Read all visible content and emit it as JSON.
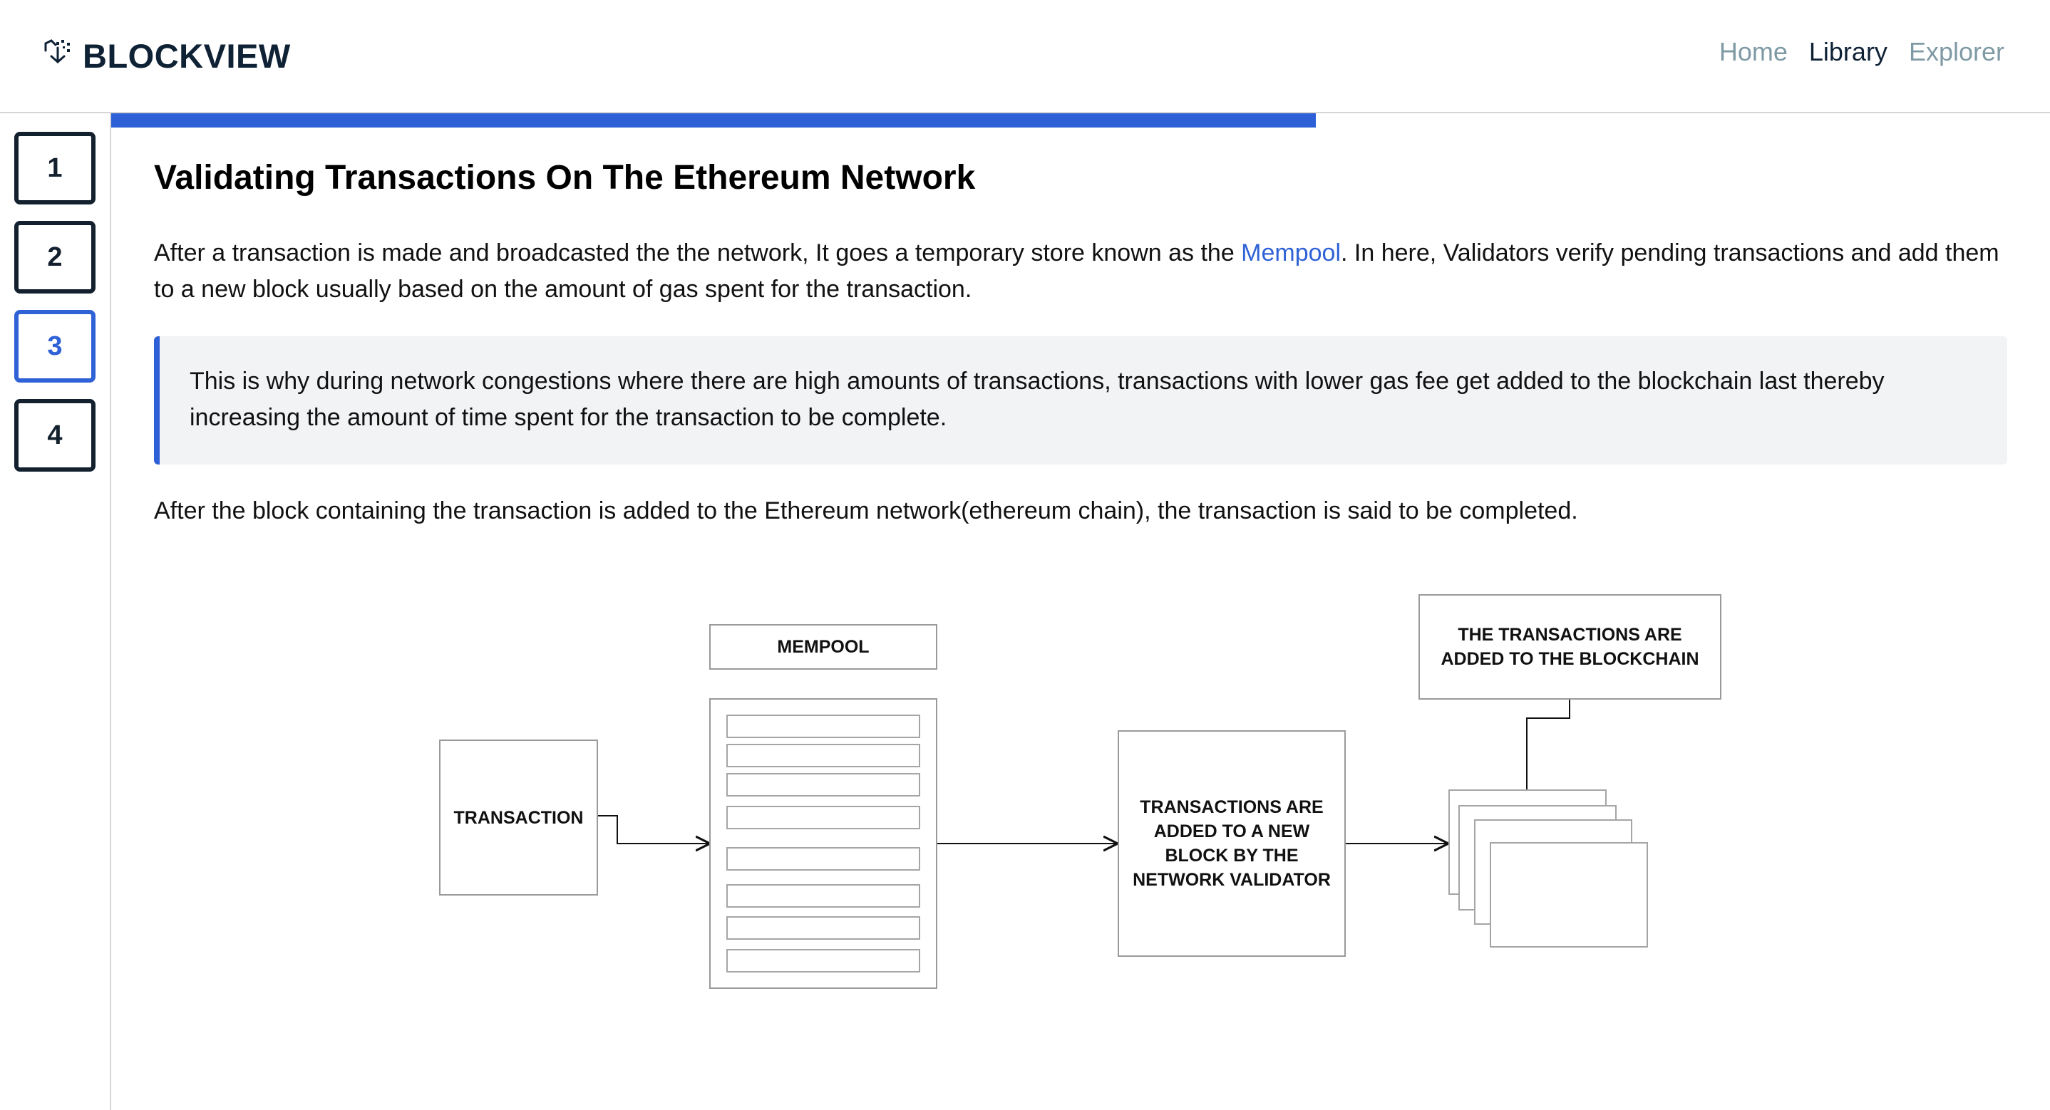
{
  "app": {
    "brand": "BLOCKVIEW",
    "brand_icon": "cube-network-icon"
  },
  "nav": {
    "items": [
      {
        "label": "Home",
        "active": false
      },
      {
        "label": "Library",
        "active": true
      },
      {
        "label": "Explorer",
        "active": false
      }
    ]
  },
  "steps": {
    "items": [
      "1",
      "2",
      "3",
      "4"
    ],
    "active_index": 2
  },
  "progress": {
    "fraction": 0.6
  },
  "article": {
    "title": "Validating Transactions On The Ethereum Network",
    "para1_before_link": "After a transaction is made and broadcasted the the network, It goes a temporary store known as the ",
    "para1_link": "Mempool",
    "para1_after_link": ". In here, Validators verify pending transactions and add them to a new block usually based on the amount of gas spent for the transaction.",
    "callout": "This is why during network congestions where there are high amounts of transactions, transactions with lower gas fee get added to the blockchain last thereby increasing the amount of time spent for the transaction to be complete.",
    "para2": "After the block containing the transaction is added to the Ethereum network(ethereum chain), the transaction is said to be completed."
  },
  "diagram": {
    "transaction_label": "TRANSACTION",
    "mempool_label": "MEMPOOL",
    "validator_label": "TRANSACTIONS ARE ADDED TO A NEW BLOCK BY THE NETWORK VALIDATOR",
    "blockchain_label": "THE TRANSACTIONS ARE ADDED TO THE BLOCKCHAIN"
  },
  "colors": {
    "accent": "#2d5fd6",
    "brand_text": "#0f2235",
    "nav_inactive": "#7f9aa5",
    "callout_bg": "#f2f3f5"
  }
}
